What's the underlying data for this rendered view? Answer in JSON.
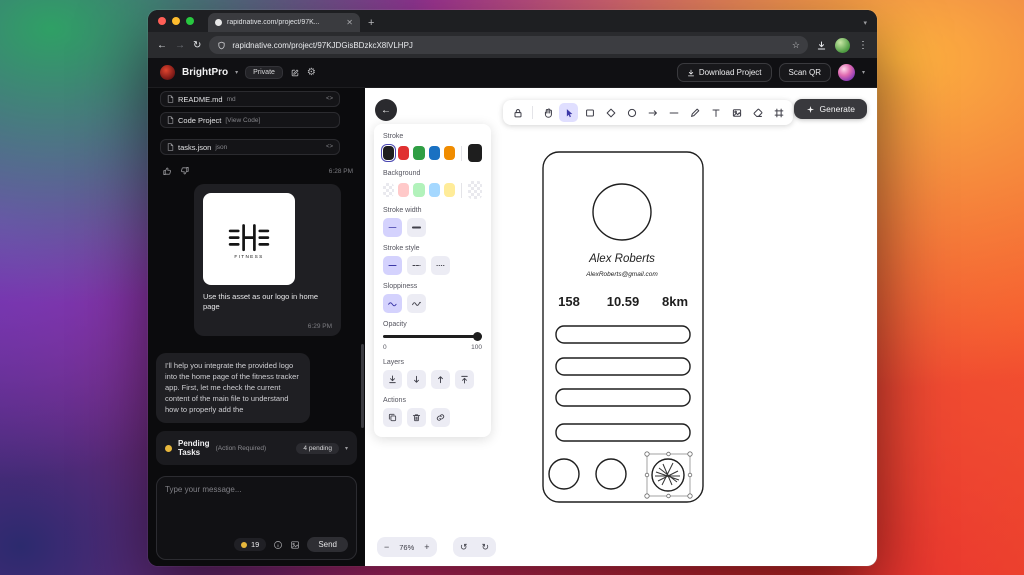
{
  "browser": {
    "tab_title": "rapidnative.com/project/97K...",
    "url": "rapidnative.com/project/97KJDGisBDzkcX8lVLHPJ"
  },
  "app_header": {
    "app_name": "BrightPro",
    "privacy_badge": "Private",
    "download_project_label": "Download Project",
    "scan_qr_label": "Scan QR"
  },
  "sidebar": {
    "files": [
      {
        "name": "README.md",
        "meta": "md"
      },
      {
        "name": "Code Project",
        "meta": "[View Code]"
      },
      {
        "name": "tasks.json",
        "meta": "json"
      }
    ],
    "message_time_1": "6:28 PM",
    "asset_caption": "Use this asset as our logo in home page",
    "asset_logo_text": "FITNESS",
    "message_time_2": "6:29 PM",
    "assistant_message": "I'll help you integrate the provided logo into the home page of the fitness tracker app. First, let me check the current content of the main file to understand how to properly add the",
    "pending_tasks": {
      "title_line1": "Pending",
      "title_line2": "Tasks",
      "subtitle": "(Action Required)",
      "count_badge": "4 pending"
    },
    "composer": {
      "placeholder": "Type your message...",
      "credits": "19",
      "send_label": "Send"
    }
  },
  "canvas": {
    "generate_label": "Generate",
    "panel": {
      "stroke_label": "Stroke",
      "background_label": "Background",
      "stroke_width_label": "Stroke width",
      "stroke_style_label": "Stroke style",
      "sloppiness_label": "Sloppiness",
      "opacity_label": "Opacity",
      "opacity_min": "0",
      "opacity_max": "100",
      "layers_label": "Layers",
      "actions_label": "Actions",
      "stroke_colors": [
        "#1e1e1e",
        "#e03131",
        "#2f9e44",
        "#1971c2",
        "#f08c00"
      ],
      "current_stroke": "#1e1e1e",
      "background_colors": [
        "transparent",
        "#ffc9c9",
        "#b2f2bb",
        "#a5d8ff",
        "#ffec99"
      ],
      "accent": "#e0dfff"
    },
    "wireframe": {
      "name": "Alex Roberts",
      "email": "AlexRoberts@gmail.com",
      "stat1": "158",
      "stat2": "10.59",
      "stat3": "8km"
    },
    "zoom_level": "76%"
  }
}
